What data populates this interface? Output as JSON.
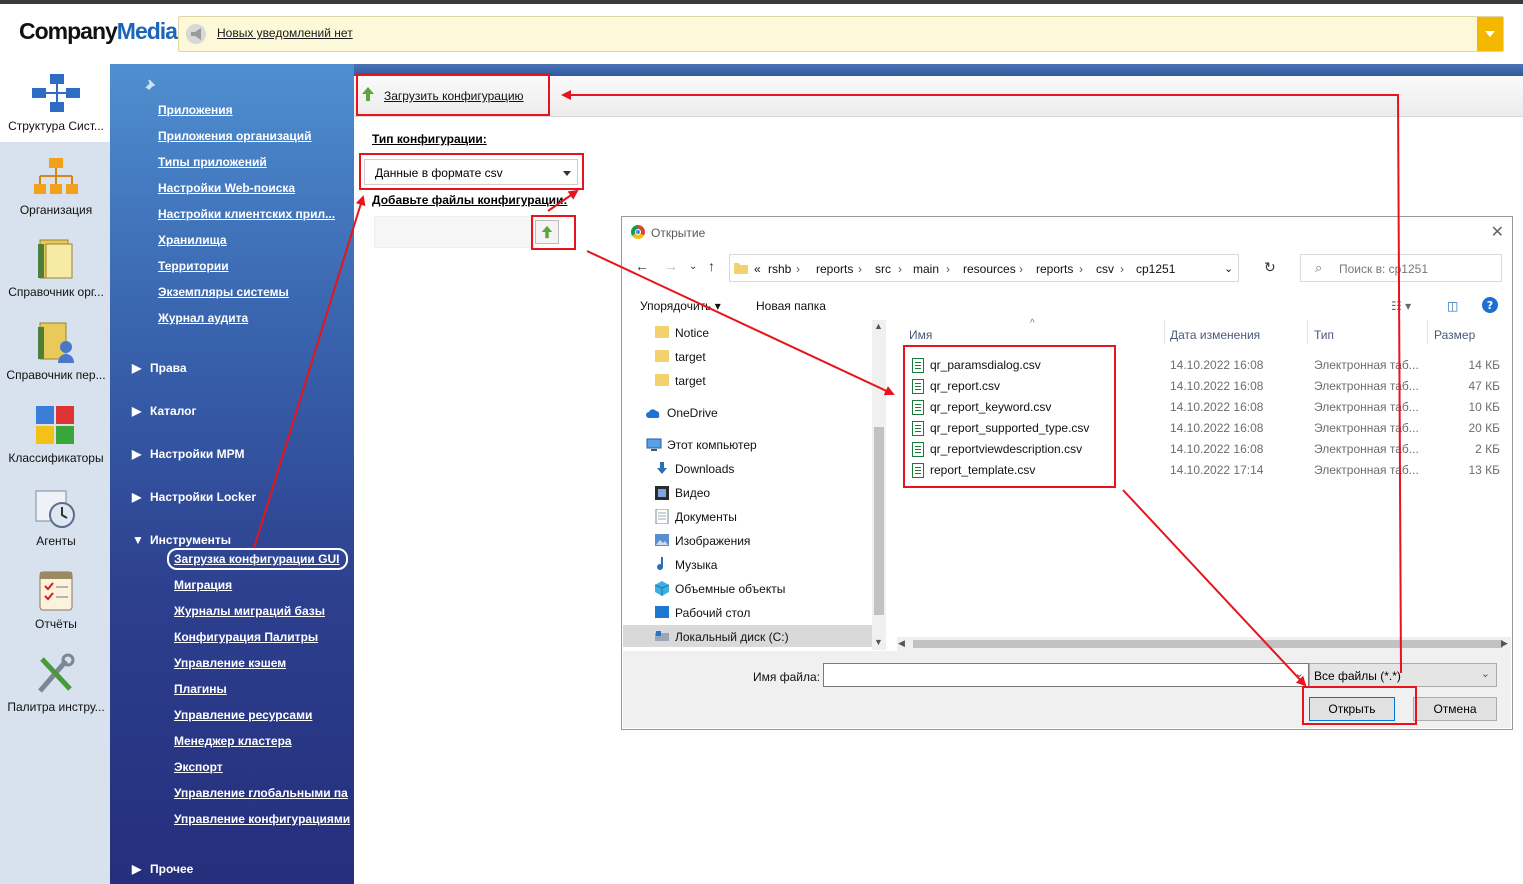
{
  "header": {
    "logo_company": "Company",
    "logo_media": "Media",
    "notification": "Новых уведомлений нет"
  },
  "rail": {
    "items": [
      {
        "label": "Структура Сист...",
        "icon": "system-structure-icon"
      },
      {
        "label": "Организация",
        "icon": "organization-icon"
      },
      {
        "label": "Справочник орг...",
        "icon": "org-directory-icon"
      },
      {
        "label": "Справочник пер...",
        "icon": "people-directory-icon"
      },
      {
        "label": "Классификаторы",
        "icon": "puzzle-icon"
      },
      {
        "label": "Агенты",
        "icon": "clock-icon"
      },
      {
        "label": "Отчёты",
        "icon": "reports-icon"
      },
      {
        "label": "Палитра инстру...",
        "icon": "tools-icon"
      }
    ]
  },
  "nav": {
    "links": [
      "Приложения",
      "Приложения организаций",
      "Типы приложений",
      "Настройки Web-поиска",
      "Настройки клиентских прил...",
      "Хранилища",
      "Территории",
      "Экземпляры системы",
      "Журнал аудита"
    ],
    "sections": [
      "Права",
      "Каталог",
      "Настройки МРМ",
      "Настройки Locker",
      "Инструменты",
      "Прочее"
    ],
    "tools_links": [
      "Загрузка конфигурации GUI",
      "Миграция",
      "Журналы миграций базы",
      "Конфигурация Палитры",
      "Управление кэшем",
      "Плагины",
      "Управление ресурсами",
      "Менеджер кластера",
      "Экспорт",
      "Управление глобальными па",
      "Управление конфигурациями"
    ]
  },
  "main": {
    "upload_link": "Загрузить конфигурацию",
    "type_label": "Тип конфигурации:",
    "type_value": "Данные в формате csv",
    "files_label": "Добавьте файлы конфигурации:"
  },
  "dialog": {
    "title": "Открытие",
    "breadcrumb": [
      "«",
      "rshb",
      "reports",
      "src",
      "main",
      "resources",
      "reports",
      "csv",
      "cp1251"
    ],
    "search_placeholder": "Поиск в: cp1251",
    "toolbar": {
      "organize": "Упорядочить ▾",
      "new_folder": "Новая папка"
    },
    "tree": [
      {
        "label": "Notice",
        "icon": "folder-icon"
      },
      {
        "label": "target",
        "icon": "folder-icon"
      },
      {
        "label": "target",
        "icon": "folder-icon"
      },
      {
        "label": "OneDrive",
        "icon": "cloud-icon"
      },
      {
        "label": "Этот компьютер",
        "icon": "computer-icon"
      },
      {
        "label": "Downloads",
        "icon": "download-icon"
      },
      {
        "label": "Видео",
        "icon": "video-icon"
      },
      {
        "label": "Документы",
        "icon": "documents-icon"
      },
      {
        "label": "Изображения",
        "icon": "images-icon"
      },
      {
        "label": "Музыка",
        "icon": "music-icon"
      },
      {
        "label": "Объемные объекты",
        "icon": "3d-objects-icon"
      },
      {
        "label": "Рабочий стол",
        "icon": "desktop-icon"
      },
      {
        "label": "Локальный диск (C:)",
        "icon": "disk-icon"
      }
    ],
    "columns": [
      "Имя",
      "Дата изменения",
      "Тип",
      "Размер"
    ],
    "files": [
      {
        "name": "qr_paramsdialog.csv",
        "date": "14.10.2022 16:08",
        "type": "Электронная таб...",
        "size": "14 КБ"
      },
      {
        "name": "qr_report.csv",
        "date": "14.10.2022 16:08",
        "type": "Электронная таб...",
        "size": "47 КБ"
      },
      {
        "name": "qr_report_keyword.csv",
        "date": "14.10.2022 16:08",
        "type": "Электронная таб...",
        "size": "10 КБ"
      },
      {
        "name": "qr_report_supported_type.csv",
        "date": "14.10.2022 16:08",
        "type": "Электронная таб...",
        "size": "20 КБ"
      },
      {
        "name": "qr_reportviewdescription.csv",
        "date": "14.10.2022 16:08",
        "type": "Электронная таб...",
        "size": "2 КБ"
      },
      {
        "name": "report_template.csv",
        "date": "14.10.2022 17:14",
        "type": "Электронная таб...",
        "size": "13 КБ"
      }
    ],
    "filename_label": "Имя файла:",
    "filename_value": "",
    "filetype": "Все файлы (*.*)",
    "open_button": "Открыть",
    "cancel_button": "Отмена"
  },
  "colors": {
    "annotation_red": "#e8131b",
    "nav_blue": "#2c3f8e",
    "accent_yellow": "#f5b800"
  }
}
